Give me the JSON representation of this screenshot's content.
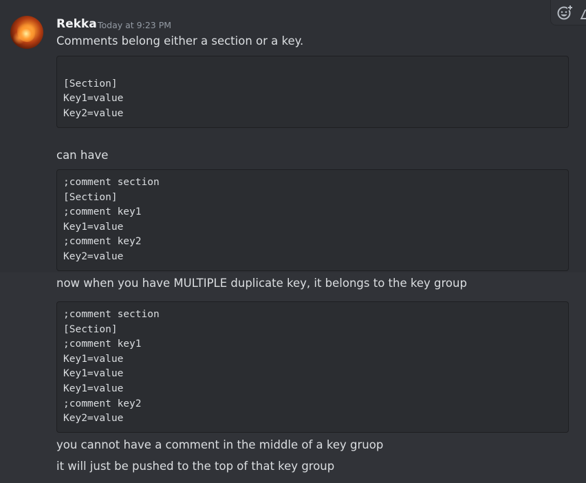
{
  "message": {
    "author": "Rekka",
    "timestamp": "Today at 9:23 PM",
    "avatar_icon": "avatar-dragon-fire",
    "lines": {
      "intro": "Comments belong either a section or a key.",
      "can_have": "can have",
      "multiple": "now when you have MULTIPLE duplicate key, it belongs to the key group",
      "cannot": "you cannot have a comment in the middle of a key gruop",
      "pushed": "it will just be pushed to the top of that key group"
    },
    "code_blocks": [
      {
        "lines": [
          "",
          "[Section]",
          "Key1=value",
          "Key2=value"
        ]
      },
      {
        "lines": [
          ";comment section",
          "[Section]",
          ";comment key1",
          "Key1=value",
          ";comment key2",
          "Key2=value"
        ]
      },
      {
        "lines": [
          ";comment section",
          "[Section]",
          ";comment key1",
          "Key1=value",
          "Key1=value",
          "Key1=value",
          ";comment key2",
          "Key2=value"
        ]
      }
    ]
  },
  "toolbar": {
    "icons": [
      "add-reaction-icon",
      "edit-icon"
    ]
  },
  "colors": {
    "background": "#313338",
    "hover_background": "#2e3035",
    "code_background": "#2b2d31",
    "text": "#dbdee1",
    "username": "#f2f3f5",
    "timestamp": "#949ba4"
  }
}
